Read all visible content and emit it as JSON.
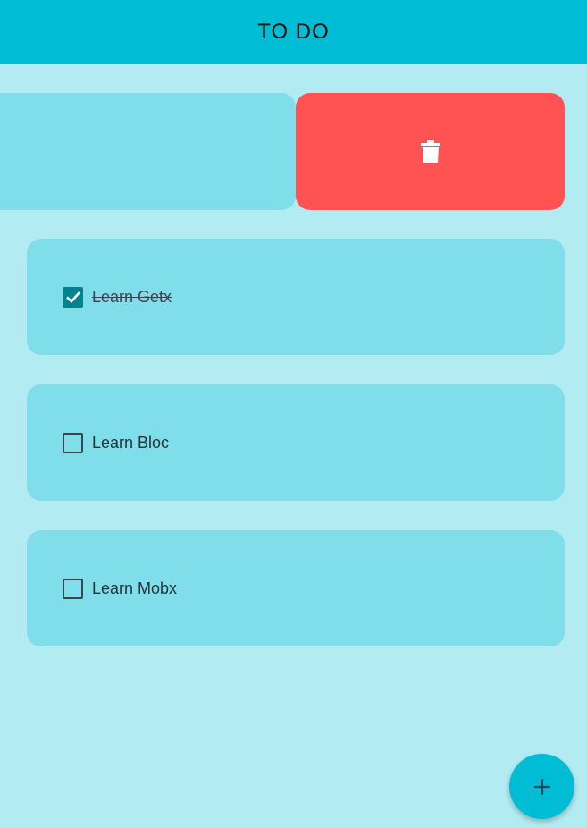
{
  "appbar": {
    "title": "TO DO"
  },
  "swipe": {
    "action_icon": "trash-icon"
  },
  "tasks": [
    {
      "label": "Learn Getx",
      "done": true
    },
    {
      "label": "Learn Bloc",
      "done": false
    },
    {
      "label": "Learn Mobx",
      "done": false
    }
  ],
  "fab": {
    "icon": "plus-icon"
  },
  "colors": {
    "appbar": "#00bcd4",
    "background": "#b2ebf2",
    "card": "#80deea",
    "delete": "#ff5252",
    "checkbox_checked": "#00838f"
  }
}
